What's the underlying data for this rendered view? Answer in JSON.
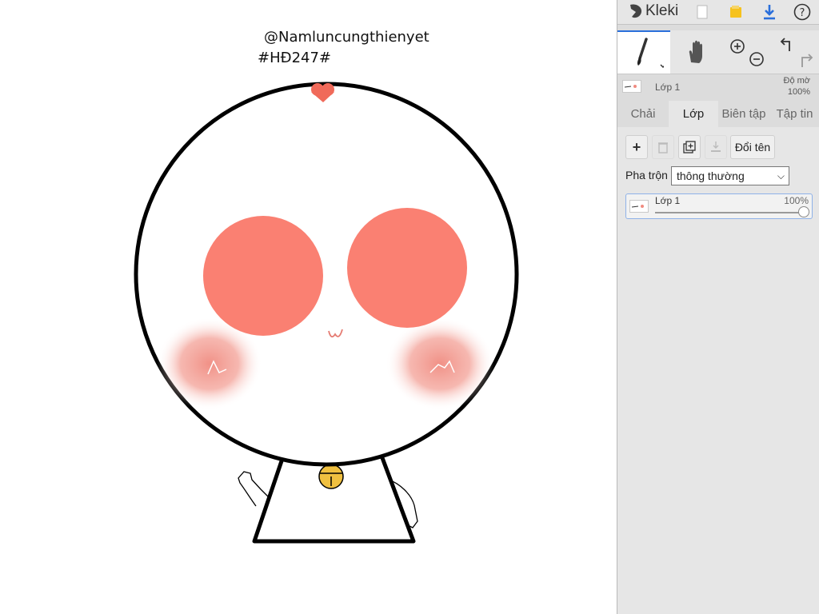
{
  "canvas": {
    "signature_line1": "@Namluncungthienyet",
    "signature_line2": "#HĐ247#",
    "drawing": "cartoon-character",
    "colors": {
      "blush": "#fa8072",
      "collar": "#e05a4a",
      "bell": "#f0c040",
      "outline": "#000000"
    }
  },
  "app": {
    "name": "Kleki",
    "icons": [
      "kleki-logo-icon",
      "new-image-icon",
      "open-folder-icon",
      "download-icon",
      "help-icon"
    ],
    "accent_color": "#2a6fdb"
  },
  "tools": {
    "items": [
      "brush-tool-icon",
      "hand-tool-icon",
      "zoom-in-icon",
      "zoom-out-icon",
      "undo-icon",
      "redo-icon"
    ],
    "active": "brush"
  },
  "layer_preview": {
    "name": "Lớp 1",
    "opacity_label": "Độ mờ",
    "opacity_value": "100%"
  },
  "tabs": [
    "Chải",
    "Lớp",
    "Biên tập",
    "Tập tin"
  ],
  "active_tab": "Lớp",
  "layers_panel": {
    "rename_label": "Đổi tên",
    "blend_label": "Pha trộn",
    "blend_value": "thông thường",
    "layers": [
      {
        "name": "Lớp 1",
        "opacity": "100%",
        "opacity_fraction": 1.0
      }
    ]
  }
}
